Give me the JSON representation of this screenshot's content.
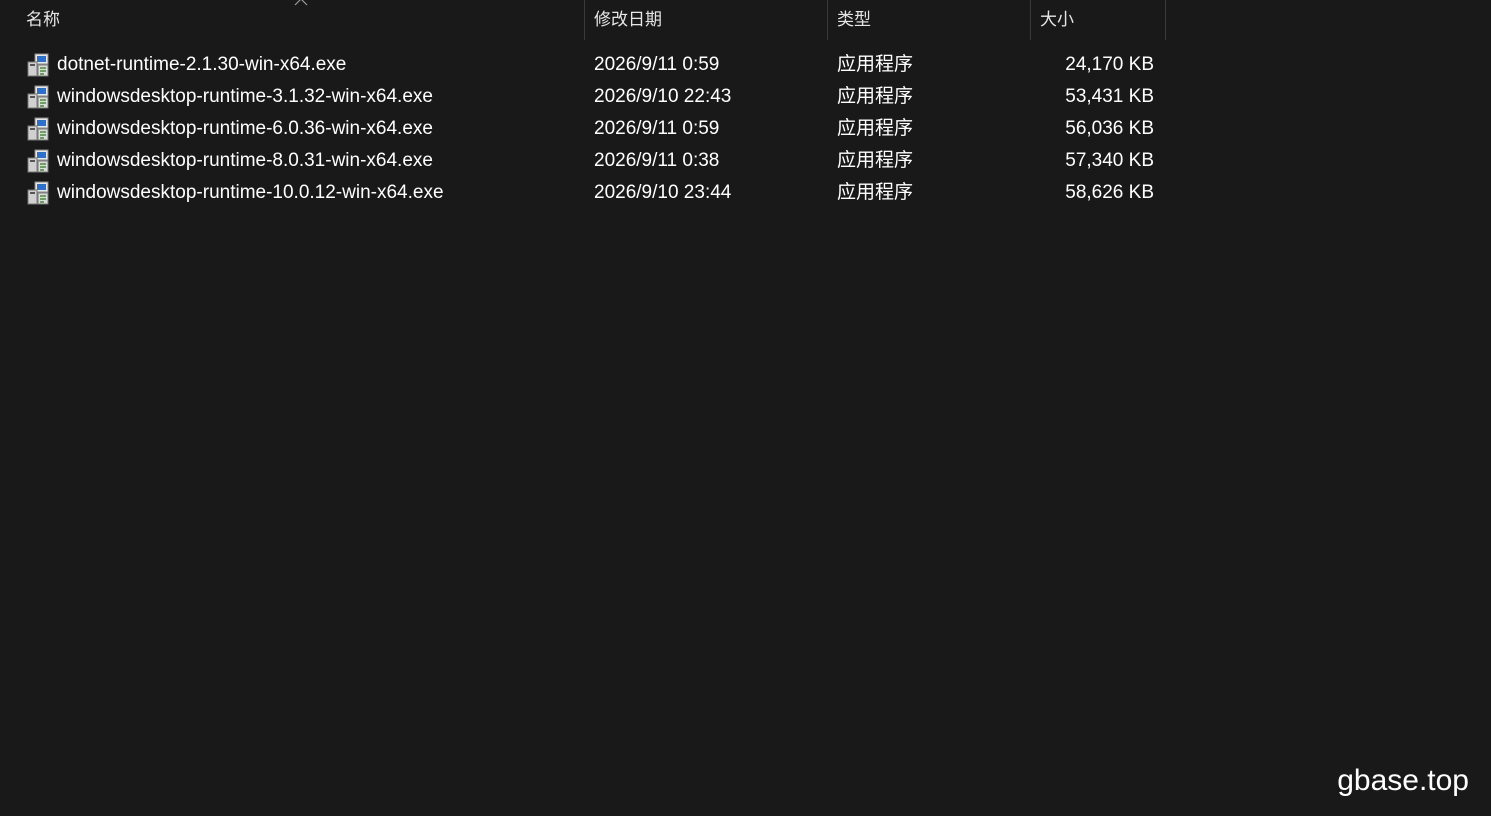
{
  "columns": {
    "name": "名称",
    "date": "修改日期",
    "type": "类型",
    "size": "大小"
  },
  "files": [
    {
      "name": "dotnet-runtime-2.1.30-win-x64.exe",
      "date": "2026/9/11 0:59",
      "type": "应用程序",
      "size": "24,170 KB",
      "icon": "installer-exe-icon"
    },
    {
      "name": "windowsdesktop-runtime-3.1.32-win-x64.exe",
      "date": "2026/9/10 22:43",
      "type": "应用程序",
      "size": "53,431 KB",
      "icon": "installer-exe-icon"
    },
    {
      "name": "windowsdesktop-runtime-6.0.36-win-x64.exe",
      "date": "2026/9/11 0:59",
      "type": "应用程序",
      "size": "56,036 KB",
      "icon": "installer-exe-icon"
    },
    {
      "name": "windowsdesktop-runtime-8.0.31-win-x64.exe",
      "date": "2026/9/11 0:38",
      "type": "应用程序",
      "size": "57,340 KB",
      "icon": "installer-exe-icon"
    },
    {
      "name": "windowsdesktop-runtime-10.0.12-win-x64.exe",
      "date": "2026/9/10 23:44",
      "type": "应用程序",
      "size": "58,626 KB",
      "icon": "installer-exe-icon"
    }
  ],
  "sort_indicator": "chevron-up-icon",
  "watermark": "gbase.top",
  "colors": {
    "background": "#191919",
    "text": "#ffffff",
    "divider": "#3a3a3a"
  }
}
